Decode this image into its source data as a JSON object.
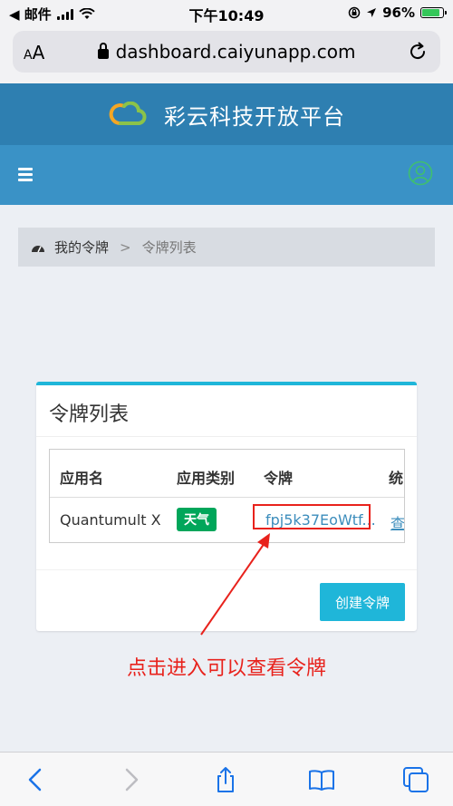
{
  "status_bar": {
    "carrier": "◀ 邮件",
    "time": "下午10:49",
    "battery_percent": "96%",
    "battery_level": 0.96,
    "battery_color": "#34c759"
  },
  "browser": {
    "text_size_label": "AA",
    "url": "dashboard.caiyunapp.com",
    "icons": [
      "lock-icon",
      "reload-icon",
      "back-icon",
      "forward-icon",
      "share-icon",
      "bookmarks-icon",
      "tabs-icon"
    ]
  },
  "site": {
    "title": "彩云科技开放平台",
    "brand_color": "#2e7fb1",
    "nav_color": "#3a92c6"
  },
  "breadcrumb": {
    "home": "我的令牌",
    "separator": ">",
    "current": "令牌列表"
  },
  "card": {
    "title": "令牌列表",
    "columns": [
      "应用名",
      "应用类别",
      "令牌",
      "统"
    ],
    "rows": [
      {
        "app_name": "Quantumult X",
        "category": "天气",
        "token": "fpj5k37EoWtf...",
        "stats": "查"
      }
    ],
    "create_button": "创建令牌",
    "accent_color": "#1fb6d9"
  },
  "annotation": {
    "text": "点击进入可以查看令牌",
    "color": "#e8221c"
  }
}
